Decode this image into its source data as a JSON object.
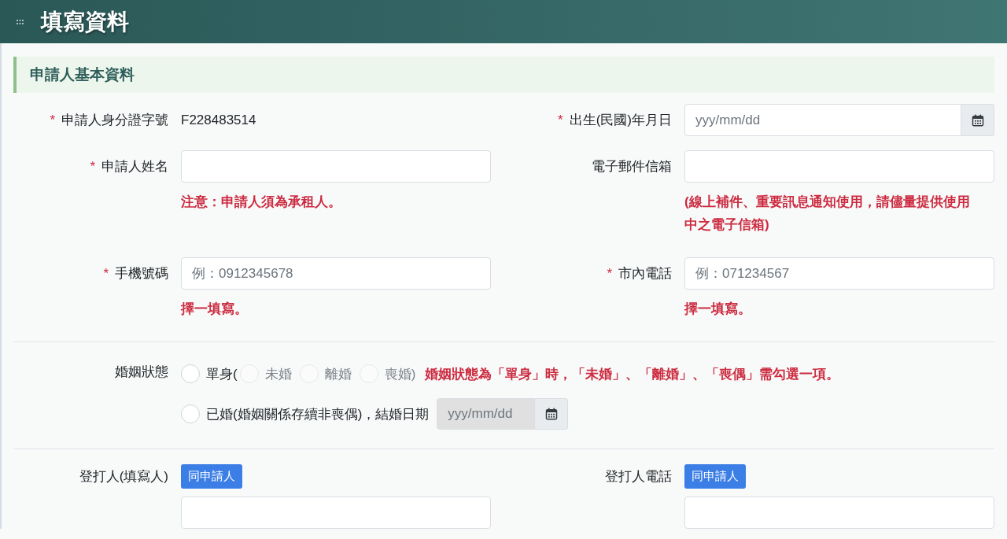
{
  "header": {
    "title": "填寫資料"
  },
  "section": {
    "title": "申請人基本資料"
  },
  "rows": [
    {
      "fields": [
        {
          "kind": "text",
          "required_mark": "*",
          "label": "申請人身分證字號",
          "value": "F228483514"
        },
        {
          "kind": "date",
          "required_mark": "*",
          "label": "出生(民國)年月日",
          "placeholder": "yyy/mm/dd",
          "disabled": false
        }
      ]
    },
    {
      "fields": [
        {
          "kind": "input",
          "required_mark": "*",
          "label": "申請人姓名",
          "help": "注意：申請人須為承租人。"
        },
        {
          "kind": "input",
          "label": "電子郵件信箱",
          "help": "(線上補件、重要訊息通知使用，請儘量提供使用中之電子信箱)"
        }
      ]
    },
    {
      "fields": [
        {
          "kind": "input",
          "required_mark": "*",
          "label": "手機號碼",
          "placeholder": "例：0912345678",
          "help": "擇一填寫。"
        },
        {
          "kind": "input",
          "required_mark": "*",
          "label": "市內電話",
          "placeholder": "例：071234567",
          "help": "擇一填寫。"
        }
      ]
    }
  ],
  "marital_status": {
    "label": "婚姻狀態",
    "options": [
      {
        "label": "單身(",
        "selected": false,
        "disabled": false,
        "children": [
          {
            "label": "未婚",
            "selected": false,
            "disabled": true
          },
          {
            "label": "離婚",
            "selected": false,
            "disabled": true
          },
          {
            "label": "喪婚)",
            "selected": false,
            "disabled": true
          }
        ],
        "note": "婚姻狀態為「單身」時，「未婚」、「離婚」、「喪偶」需勾選一項。"
      },
      {
        "label": "已婚(婚姻關係存續非喪偶)，結婚日期",
        "selected": false,
        "disabled": false,
        "date_field": {
          "placeholder": "yyy/mm/dd",
          "disabled": true
        }
      }
    ]
  },
  "typist": {
    "fields": [
      {
        "kind": "input",
        "label": "登打人(填寫人)",
        "button": "同申請人"
      },
      {
        "kind": "input",
        "label": "登打人電話",
        "button": "同申請人"
      }
    ]
  }
}
